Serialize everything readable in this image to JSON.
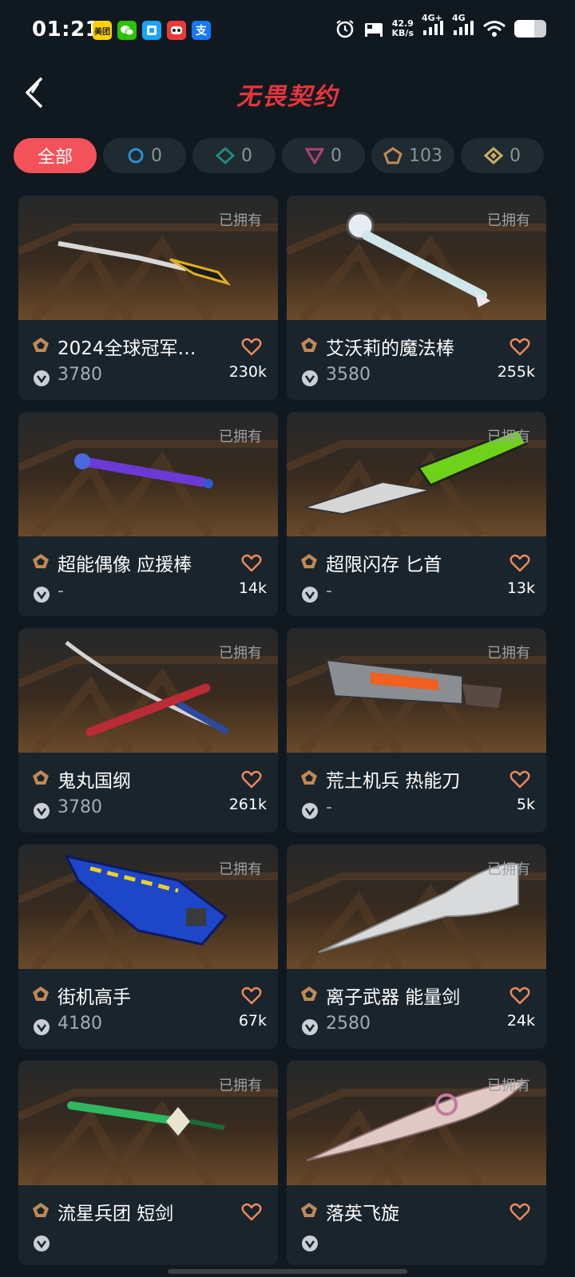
{
  "status_bar": {
    "time": "01:21",
    "apps": [
      {
        "icon": "meituan-icon",
        "label": "美团",
        "color": "#ffd100"
      },
      {
        "icon": "wechat-icon",
        "label": "",
        "color": "#2dc100"
      },
      {
        "icon": "app-blue-icon",
        "label": "",
        "color": "#1aa3ff"
      },
      {
        "icon": "app-red-icon",
        "label": "",
        "color": "#e83a3a"
      },
      {
        "icon": "alipay-icon",
        "label": "支",
        "color": "#1677ff"
      }
    ],
    "net_speed_value": "42.9",
    "net_speed_unit": "KB/s",
    "signal1": "4G+",
    "signal2": "4G",
    "battery_level": 0.62
  },
  "header": {
    "title": "无畏契约",
    "title_color": "#e8353c"
  },
  "filters": [
    {
      "label": "全部",
      "icon": null,
      "active": true
    },
    {
      "label": "0",
      "icon": "tier-select-icon",
      "color": "#2a8fd0"
    },
    {
      "label": "0",
      "icon": "tier-deluxe-icon",
      "color": "#1e8a80"
    },
    {
      "label": "0",
      "icon": "tier-premium-icon",
      "color": "#b0407a"
    },
    {
      "label": "103",
      "icon": "tier-exclusive-icon",
      "color": "#c08a55"
    },
    {
      "label": "0",
      "icon": "tier-ultra-icon",
      "color": "#c9b060"
    }
  ],
  "owned_label": "已拥有",
  "items": [
    {
      "name": "2024全球冠军…",
      "price": "3780",
      "likes": "230k",
      "weapon": "karambit-icon"
    },
    {
      "name": "艾沃莉的魔法棒",
      "price": "3580",
      "likes": "255k",
      "weapon": "magic-wand-icon"
    },
    {
      "name": "超能偶像 应援棒",
      "price": "-",
      "likes": "14k",
      "weapon": "cheer-stick-icon"
    },
    {
      "name": "超限闪存 匕首",
      "price": "-",
      "likes": "13k",
      "weapon": "dagger-icon"
    },
    {
      "name": "鬼丸国纲",
      "price": "3780",
      "likes": "261k",
      "weapon": "katana-icon"
    },
    {
      "name": "荒土机兵 热能刀",
      "price": "-",
      "likes": "5k",
      "weapon": "heat-blade-icon"
    },
    {
      "name": "街机高手",
      "price": "4180",
      "likes": "67k",
      "weapon": "arcade-blade-icon"
    },
    {
      "name": "离子武器 能量剑",
      "price": "2580",
      "likes": "24k",
      "weapon": "ion-sword-icon"
    },
    {
      "name": "流星兵团 短剑",
      "price": "",
      "likes": "",
      "weapon": "short-sword-icon"
    },
    {
      "name": "落英飞旋",
      "price": "",
      "likes": "",
      "weapon": "flying-blade-icon"
    }
  ]
}
